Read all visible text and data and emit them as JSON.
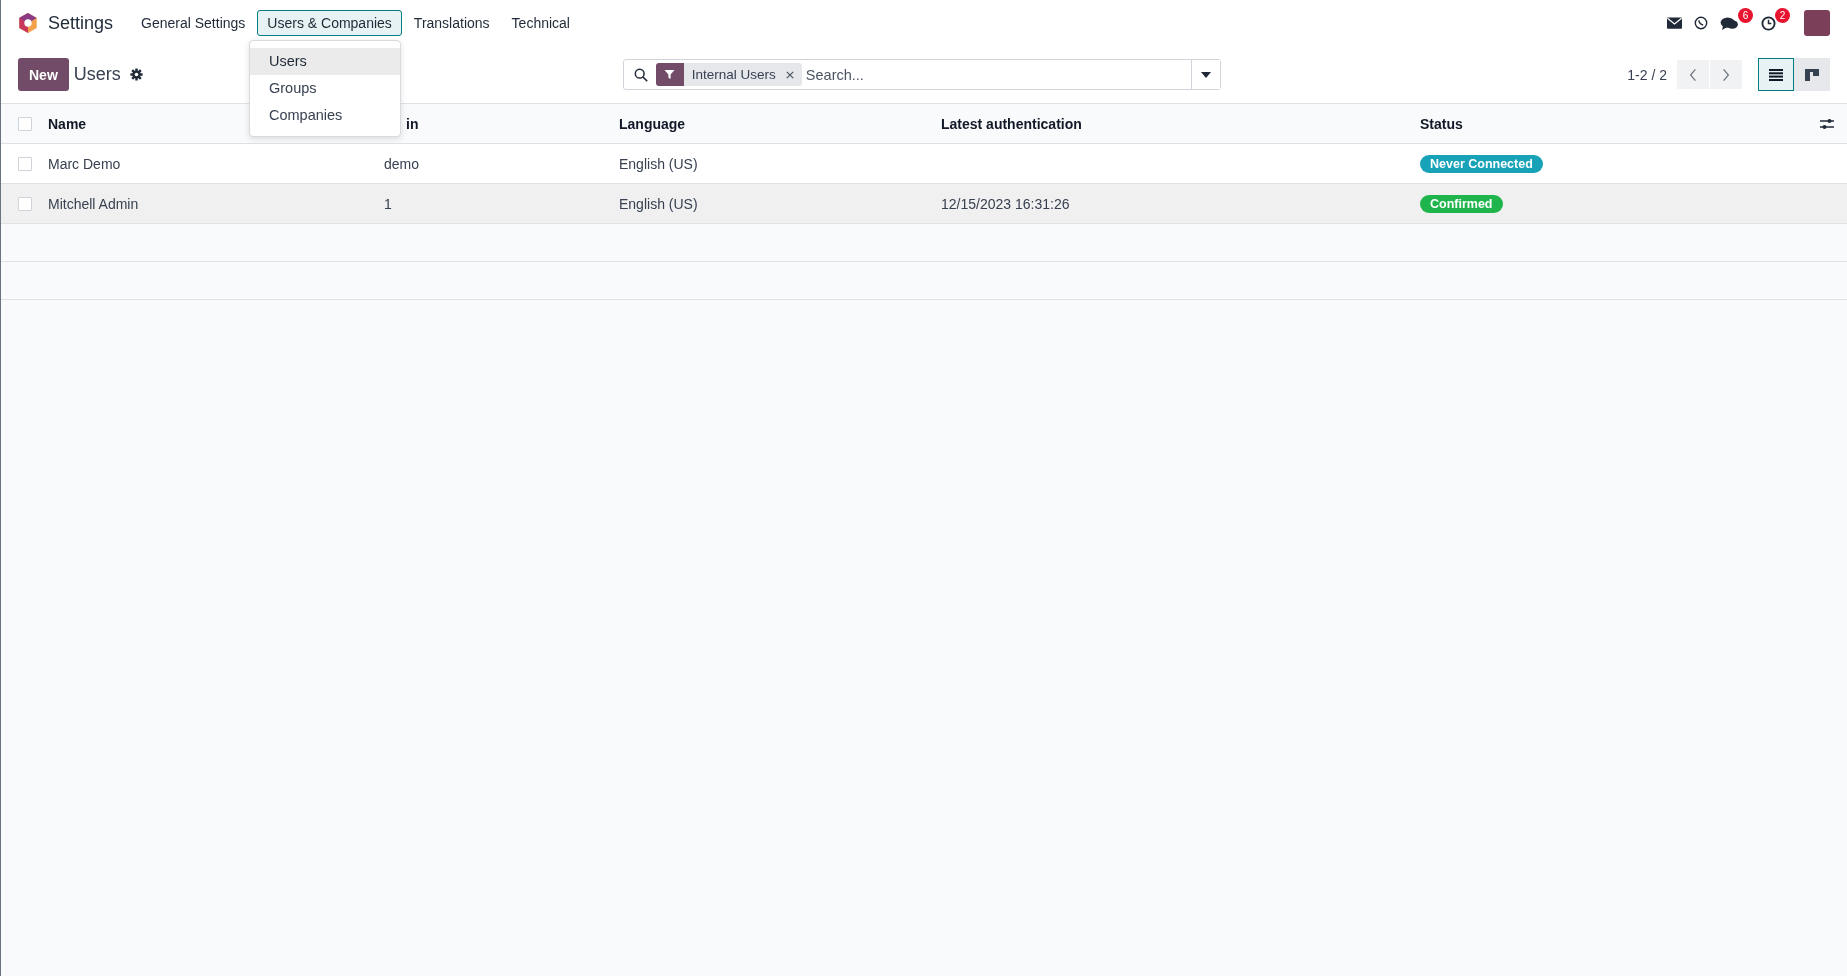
{
  "app": {
    "title": "Settings"
  },
  "menu": [
    {
      "label": "General Settings",
      "selected": false
    },
    {
      "label": "Users & Companies",
      "selected": true
    },
    {
      "label": "Translations",
      "selected": false
    },
    {
      "label": "Technical",
      "selected": false
    }
  ],
  "dropdown": [
    {
      "label": "Users",
      "selected": true
    },
    {
      "label": "Groups",
      "selected": false
    },
    {
      "label": "Companies",
      "selected": false
    }
  ],
  "systray": {
    "messages_count": "6",
    "activities_count": "2"
  },
  "control_panel": {
    "new_button": "New",
    "breadcrumb": "Users",
    "facet": "Internal Users",
    "search": {
      "placeholder": "Search..."
    },
    "pager": "1-2 / 2",
    "views": [
      {
        "kind": "list",
        "selected": true
      },
      {
        "kind": "kanban",
        "selected": false
      }
    ]
  },
  "table": {
    "select_all": {
      "checked": false
    },
    "columns": [
      "Name",
      "in",
      "Language",
      "Latest authentication",
      "Status"
    ],
    "rows": [
      {
        "checked": false,
        "hovered": false,
        "name": "Marc Demo",
        "login": "demo",
        "language": "English (US)",
        "latest_authentication": "",
        "status": {
          "label": "Never Connected",
          "color": "#17a2b8"
        }
      },
      {
        "checked": false,
        "hovered": true,
        "name": "Mitchell Admin",
        "login": "1",
        "language": "English (US)",
        "latest_authentication": "12/15/2023 16:31:26",
        "status": {
          "label": "Confirmed",
          "color": "#1fb54c"
        }
      }
    ]
  }
}
